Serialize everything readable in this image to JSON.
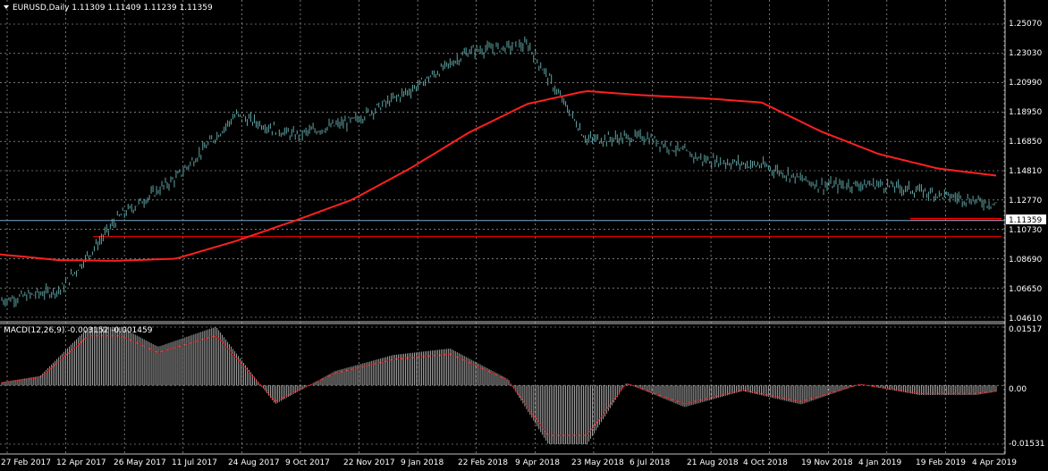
{
  "window": {
    "symbol_info": "EURUSD,Daily  1.11309 1.11409 1.11239 1.11359"
  },
  "price_panel": {
    "price_ticks": [
      "1.25070",
      "1.23030",
      "1.20990",
      "1.18950",
      "1.16850",
      "1.14810",
      "1.12770",
      "1.10730",
      "1.08690",
      "1.06650",
      "1.04610"
    ],
    "current_price_label": "1.11359",
    "current_price": 1.11359
  },
  "macd_panel": {
    "title": "MACD(12,26,9) -0.003152 -0.001459",
    "ticks": [
      "0.01517",
      "0.00",
      "-0.01531"
    ]
  },
  "time_axis": {
    "labels": [
      "27 Feb 2017",
      "12 Apr 2017",
      "26 May 2017",
      "11 Jul 2017",
      "24 Aug 2017",
      "9 Oct 2017",
      "22 Nov 2017",
      "9 Jan 2018",
      "22 Feb 2018",
      "9 Apr 2018",
      "23 May 2018",
      "6 Jul 2018",
      "21 Aug 2018",
      "4 Oct 2018",
      "19 Nov 2018",
      "4 Jan 2019",
      "19 Feb 2019",
      "4 Apr 2019"
    ]
  },
  "colors": {
    "background": "#000000",
    "grid": "#c0c0c0",
    "candles": "#5fa3a3",
    "ma": "#ff2020",
    "level": "#ff0000",
    "macd_hist": "#c8c8c8",
    "signal": "#ff2020",
    "current_line": "#7fa7c7"
  },
  "chart_data": {
    "type": "line",
    "series": [
      {
        "values": [
          {
            "x": "27 Feb 2017",
            "y": 1.058
          },
          {
            "x": "12 Apr 2017",
            "y": 1.065
          },
          {
            "x": "26 May 2017",
            "y": 1.116
          },
          {
            "x": "11 Jul 2017",
            "y": 1.144
          },
          {
            "x": "24 Aug 2017",
            "y": 1.187
          },
          {
            "x": "9 Oct 2017",
            "y": 1.173
          },
          {
            "x": "22 Nov 2017",
            "y": 1.183
          },
          {
            "x": "9 Jan 2018",
            "y": 1.205
          },
          {
            "x": "22 Feb 2018",
            "y": 1.232
          },
          {
            "x": "9 Apr 2018",
            "y": 1.236
          },
          {
            "x": "23 May 2018",
            "y": 1.17
          },
          {
            "x": "6 Jul 2018",
            "y": 1.172
          },
          {
            "x": "21 Aug 2018",
            "y": 1.156
          },
          {
            "x": "4 Oct 2018",
            "y": 1.152
          },
          {
            "x": "19 Nov 2018",
            "y": 1.138
          },
          {
            "x": "4 Jan 2019",
            "y": 1.139
          },
          {
            "x": "19 Feb 2019",
            "y": 1.132
          },
          {
            "x": "4 Apr 2019",
            "y": 1.125
          }
        ]
      },
      {
        "values": [
          {
            "x": "27 Feb 2017",
            "y": 1.09
          },
          {
            "x": "12 Apr 2017",
            "y": 1.086
          },
          {
            "x": "26 May 2017",
            "y": 1.0855
          },
          {
            "x": "11 Jul 2017",
            "y": 1.087
          },
          {
            "x": "24 Aug 2017",
            "y": 1.099
          },
          {
            "x": "9 Oct 2017",
            "y": 1.113
          },
          {
            "x": "22 Nov 2017",
            "y": 1.128
          },
          {
            "x": "9 Jan 2018",
            "y": 1.15
          },
          {
            "x": "22 Feb 2018",
            "y": 1.175
          },
          {
            "x": "9 Apr 2018",
            "y": 1.195
          },
          {
            "x": "23 May 2018",
            "y": 1.204
          },
          {
            "x": "6 Jul 2018",
            "y": 1.201
          },
          {
            "x": "21 Aug 2018",
            "y": 1.199
          },
          {
            "x": "4 Oct 2018",
            "y": 1.196
          },
          {
            "x": "19 Nov 2018",
            "y": 1.176
          },
          {
            "x": "4 Jan 2019",
            "y": 1.16
          },
          {
            "x": "19 Feb 2019",
            "y": 1.15
          },
          {
            "x": "4 Apr 2019",
            "y": 1.145
          }
        ]
      }
    ],
    "levels": [
      1.1025,
      1.114,
      1.115
    ],
    "ylim": [
      1.0461,
      1.2507
    ],
    "macd_ylim": [
      -0.01531,
      0.01517
    ],
    "grid": true
  }
}
